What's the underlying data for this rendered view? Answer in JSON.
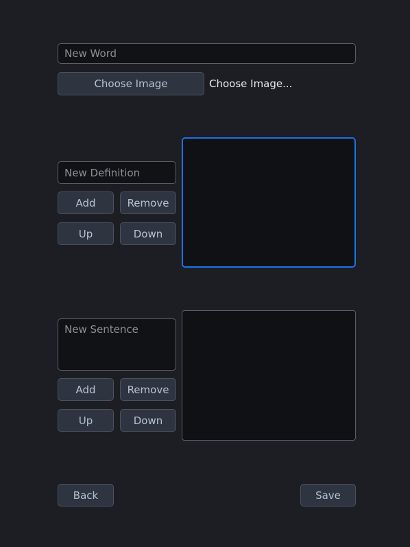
{
  "word_section": {
    "word_input_placeholder": "New Word",
    "word_input_value": "",
    "choose_image_button_label": "Choose Image",
    "choose_image_status_label": "Choose Image..."
  },
  "definition_section": {
    "input_placeholder": "New Definition",
    "input_value": "",
    "add_label": "Add",
    "remove_label": "Remove",
    "up_label": "Up",
    "down_label": "Down",
    "list_items": []
  },
  "sentence_section": {
    "input_placeholder": "New Sentence",
    "input_value": "",
    "add_label": "Add",
    "remove_label": "Remove",
    "up_label": "Up",
    "down_label": "Down",
    "list_items": []
  },
  "footer": {
    "back_label": "Back",
    "save_label": "Save"
  },
  "colors": {
    "background": "#1d1e24",
    "field_background": "#111216",
    "button_background": "#2e3440",
    "button_border": "#4b525e",
    "button_text": "#b6c3d4",
    "placeholder_text": "#8b9097",
    "label_text": "#e6eaf0",
    "focus_accent": "#1a73e8",
    "border_muted": "#5a6068"
  }
}
